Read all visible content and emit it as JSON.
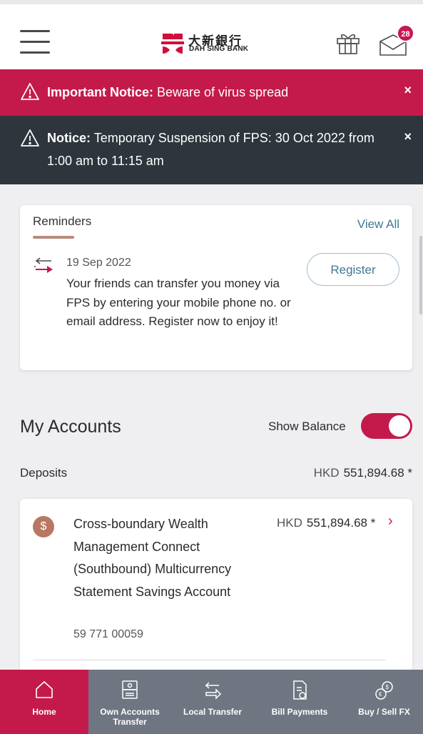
{
  "header": {
    "logo_cn": "大新銀行",
    "logo_en": "DAH SING BANK",
    "mail_badge": "28",
    "icons": [
      "hamburger-menu-icon",
      "gift-icon",
      "mail-icon"
    ]
  },
  "notices": {
    "important": {
      "title": "Important Notice:",
      "text": " Beware of virus spread",
      "close": "×"
    },
    "fps": {
      "title": "Notice:",
      "text": " Temporary Suspension of FPS: 30 Oct 2022 from 1:00 am to 11:15 am",
      "close": "×"
    }
  },
  "reminders": {
    "title": "Reminders",
    "view_all": "View All",
    "item": {
      "date": "19 Sep 2022",
      "text": "Your friends can transfer you money via FPS by entering your mobile phone no. or email address. Register now to enjoy it!",
      "button": "Register"
    }
  },
  "accounts": {
    "title": "My Accounts",
    "show_balance_label": "Show Balance",
    "show_balance_on": true,
    "deposits_label": "Deposits",
    "deposits_currency": "HKD",
    "deposits_total": "551,894.68 *",
    "items": [
      {
        "icon_symbol": "$",
        "name": "Cross-boundary Wealth Management Connect (Southbound) Multicurrency Statement Savings Account",
        "number": "59 771 00059",
        "currency": "HKD",
        "balance": "551,894.68 *",
        "chevron": "›"
      }
    ]
  },
  "bottom_nav": {
    "items": [
      {
        "label": "Home",
        "icon": "home-icon",
        "active": true
      },
      {
        "label": "Own Accounts Transfer",
        "icon": "own-accounts-transfer-icon",
        "active": false
      },
      {
        "label": "Local Transfer",
        "icon": "local-transfer-icon",
        "active": false
      },
      {
        "label": "Bill Payments",
        "icon": "bill-payments-icon",
        "active": false
      },
      {
        "label": "Buy / Sell FX",
        "icon": "buy-sell-fx-icon",
        "active": false
      }
    ]
  },
  "colors": {
    "brand": "#c41a4b",
    "dark_notice": "#2e353c",
    "link": "#3f7a97",
    "nav_bg": "#6f7681"
  }
}
